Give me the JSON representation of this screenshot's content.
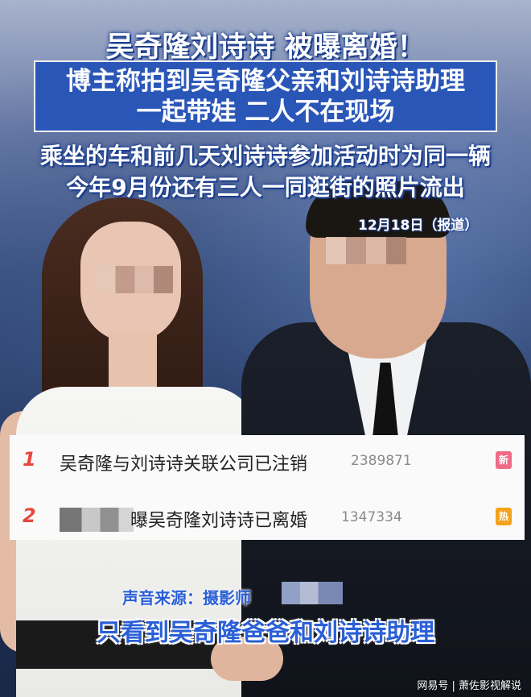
{
  "headline": {
    "title": "吴奇隆刘诗诗 被曝离婚！",
    "box_line1": "博主称拍到吴奇隆父亲和刘诗诗助理",
    "box_line2": "一起带娃 二人不在现场",
    "sub_line1": "乘坐的车和前几天刘诗诗参加活动时为同一辆",
    "sub_line2": "今年9月份还有三人一同逛街的照片流出",
    "date": "12月18日（报道）"
  },
  "hot_search": {
    "items": [
      {
        "rank": "1",
        "title": "吴奇隆与刘诗诗关联公司已注销",
        "count": "2389871",
        "badge": "新",
        "badge_type": "new"
      },
      {
        "rank": "2",
        "title": "曝吴奇隆刘诗诗已离婚",
        "count": "1347334",
        "badge": "热",
        "badge_type": "hot"
      }
    ]
  },
  "caption": {
    "line1": "声音来源：摄影师",
    "line2": "只看到吴奇隆爸爸和刘诗诗助理"
  },
  "watermark": "网易号 | 萧佐影视解说",
  "colors": {
    "headline_box": "#2a56b8",
    "caption_text": "#2a5fd6",
    "rank_red": "#e8473f"
  }
}
